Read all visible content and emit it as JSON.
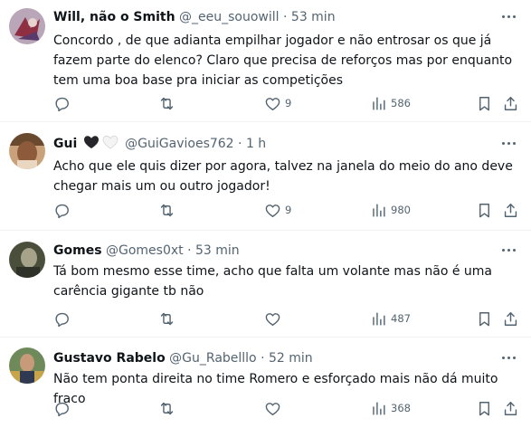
{
  "tweets": [
    {
      "name": "Will, não o Smith",
      "handle": "@_eeu_souowill",
      "dot": "·",
      "time": "53 min",
      "text": "Concordo , de que adianta empilhar jogador e não entrosar os que já fazem parte do elenco? Claro que precisa de reforços mas por enquanto tem uma boa base pra iniciar as competições",
      "likes": "9",
      "views": "586",
      "replies": "",
      "retweets": ""
    },
    {
      "name": "Gui",
      "handle": "@GuiGavioes762",
      "dot": "·",
      "time": "1 h",
      "text": "Acho que ele quis dizer por agora, talvez na janela do meio do ano deve chegar mais um ou outro jogador!",
      "likes": "9",
      "views": "980",
      "replies": "",
      "retweets": ""
    },
    {
      "name": "Gomes",
      "handle": "@Gomes0xt",
      "dot": "·",
      "time": "53 min",
      "text": "Tá bom mesmo esse time, acho que falta um volante mas não é uma carência gigante tb não",
      "likes": "",
      "views": "487",
      "replies": "",
      "retweets": ""
    },
    {
      "name": "Gustavo Rabelo",
      "handle": "@Gu_Rabelllo",
      "dot": "·",
      "time": "52 min",
      "text": "Não tem ponta direita no time Romero e esforçado mais não dá muito fraco",
      "likes": "",
      "views": "368",
      "replies": "",
      "retweets": ""
    }
  ],
  "icons": {
    "reply": "reply-icon",
    "retweet": "retweet-icon",
    "like": "heart-icon",
    "views": "analytics-icon",
    "bookmark": "bookmark-icon",
    "share": "share-icon",
    "more": "more-icon"
  },
  "colors": {
    "text": "#0f1419",
    "secondary": "#536471",
    "divider": "#eff3f4"
  }
}
